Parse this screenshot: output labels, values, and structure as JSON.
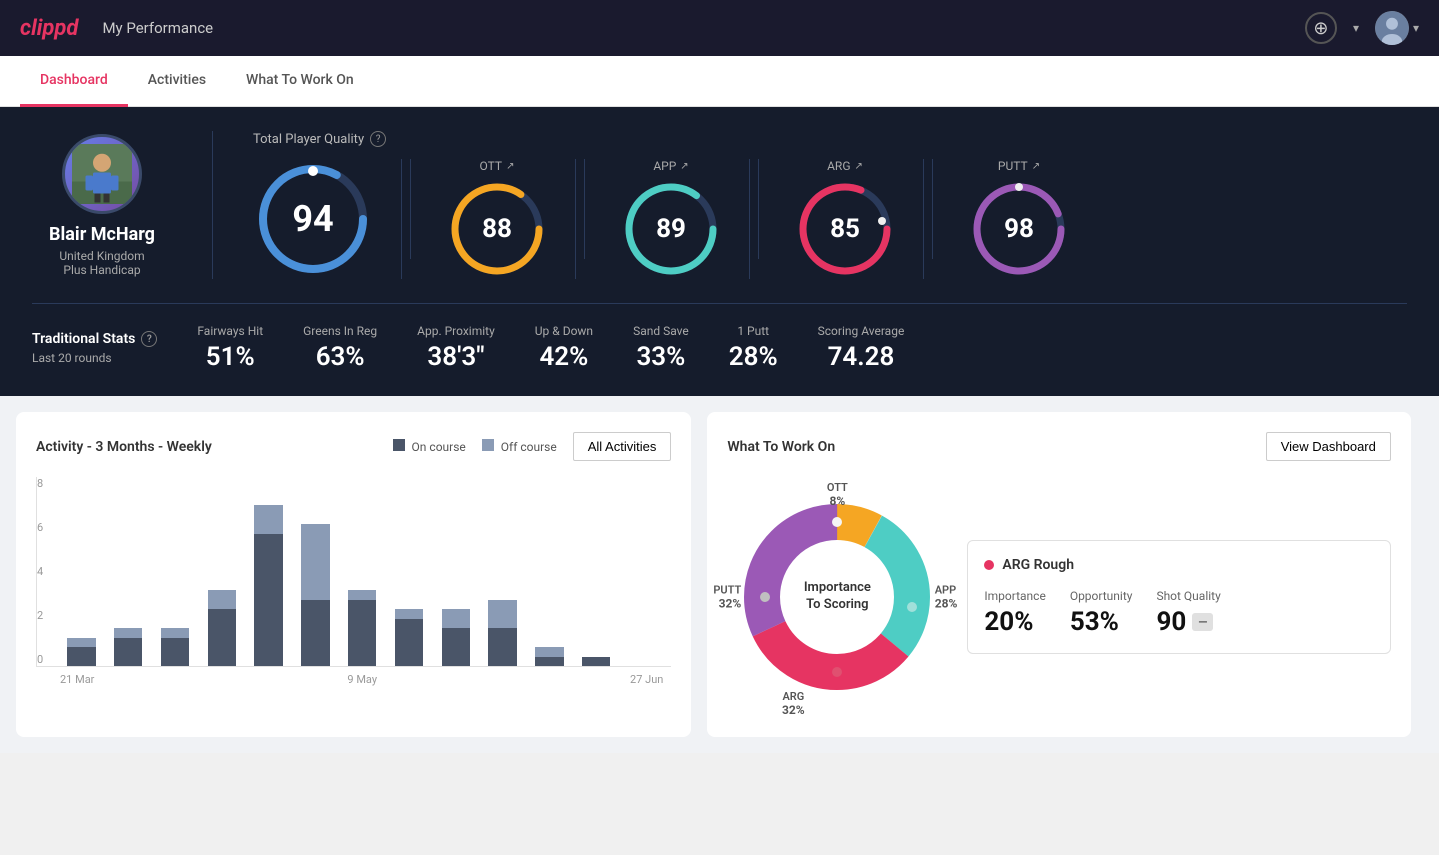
{
  "header": {
    "logo": "clippd",
    "title": "My Performance",
    "add_icon": "+",
    "chevron": "▾"
  },
  "nav": {
    "tabs": [
      {
        "label": "Dashboard",
        "active": true
      },
      {
        "label": "Activities",
        "active": false
      },
      {
        "label": "What To Work On",
        "active": false
      }
    ]
  },
  "player": {
    "name": "Blair McHarg",
    "country": "United Kingdom",
    "handicap": "Plus Handicap"
  },
  "total_quality": {
    "label": "Total Player Quality",
    "value": 94,
    "color": "#4a90d9"
  },
  "gauges": [
    {
      "label": "OTT",
      "value": 88,
      "color": "#f5a623",
      "trend": "↗"
    },
    {
      "label": "APP",
      "value": 89,
      "color": "#4ecdc4",
      "trend": "↗"
    },
    {
      "label": "ARG",
      "value": 85,
      "color": "#e63462",
      "trend": "↗"
    },
    {
      "label": "PUTT",
      "value": 98,
      "color": "#9b59b6",
      "trend": "↗"
    }
  ],
  "traditional_stats": {
    "label": "Traditional Stats",
    "period": "Last 20 rounds",
    "stats": [
      {
        "label": "Fairways Hit",
        "value": "51%"
      },
      {
        "label": "Greens In Reg",
        "value": "63%"
      },
      {
        "label": "App. Proximity",
        "value": "38'3\""
      },
      {
        "label": "Up & Down",
        "value": "42%"
      },
      {
        "label": "Sand Save",
        "value": "33%"
      },
      {
        "label": "1 Putt",
        "value": "28%"
      },
      {
        "label": "Scoring Average",
        "value": "74.28"
      }
    ]
  },
  "activity_chart": {
    "title": "Activity - 3 Months - Weekly",
    "legend": {
      "on_course": "On course",
      "off_course": "Off course"
    },
    "all_activities_btn": "All Activities",
    "y_labels": [
      "0",
      "2",
      "4",
      "6",
      "8"
    ],
    "x_labels": [
      "21 Mar",
      "9 May",
      "27 Jun"
    ],
    "bars": [
      {
        "on": 1,
        "off": 0.5
      },
      {
        "on": 1.5,
        "off": 0.5
      },
      {
        "on": 1.5,
        "off": 0.5
      },
      {
        "on": 3,
        "off": 1
      },
      {
        "on": 7,
        "off": 1.5
      },
      {
        "on": 3.5,
        "off": 4
      },
      {
        "on": 3.5,
        "off": 0.5
      },
      {
        "on": 2.5,
        "off": 0.5
      },
      {
        "on": 2,
        "off": 1
      },
      {
        "on": 2,
        "off": 1.5
      },
      {
        "on": 0.5,
        "off": 0.5
      },
      {
        "on": 0.5,
        "off": 0
      },
      {
        "on": 0,
        "off": 0
      }
    ]
  },
  "what_to_work_on": {
    "title": "What To Work On",
    "view_dashboard_btn": "View Dashboard",
    "donut_center": "Importance\nTo Scoring",
    "segments": [
      {
        "label": "OTT",
        "value": "8%",
        "color": "#f5a623"
      },
      {
        "label": "APP",
        "value": "28%",
        "color": "#4ecdc4"
      },
      {
        "label": "ARG",
        "value": "32%",
        "color": "#e63462"
      },
      {
        "label": "PUTT",
        "value": "32%",
        "color": "#9b59b6"
      }
    ],
    "info_card": {
      "title": "ARG Rough",
      "metrics": [
        {
          "label": "Importance",
          "value": "20%"
        },
        {
          "label": "Opportunity",
          "value": "53%"
        },
        {
          "label": "Shot Quality",
          "value": "90",
          "badge": ""
        }
      ]
    }
  }
}
